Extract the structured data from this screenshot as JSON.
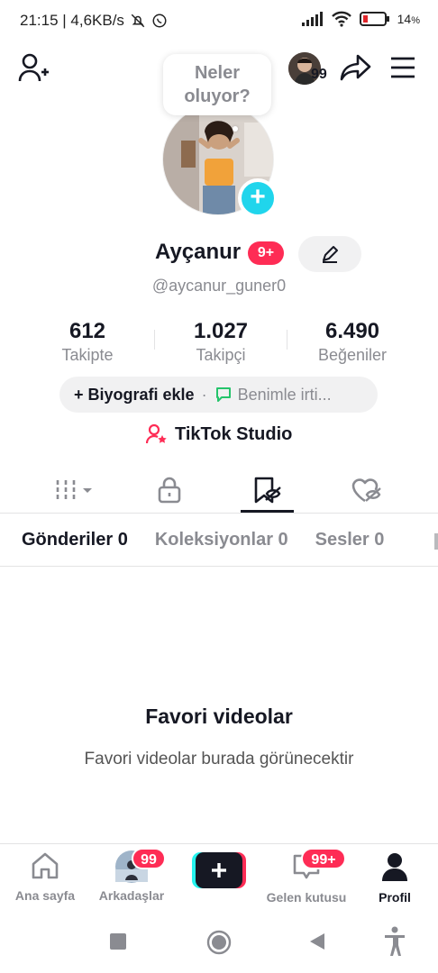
{
  "status_bar": {
    "time_speed": "21:15 | 4,6KB/s",
    "battery": "14",
    "battery_unit": "%"
  },
  "header": {
    "story_badge": "99",
    "bubble_line1": "Neler",
    "bubble_line2": "oluyor?"
  },
  "profile": {
    "display_name": "Ayçanur",
    "name_badge": "9+",
    "handle": "@aycanur_guner0"
  },
  "stats": [
    {
      "value": "612",
      "label": "Takipte"
    },
    {
      "value": "1.027",
      "label": "Takipçi"
    },
    {
      "value": "6.490",
      "label": "Beğeniler"
    }
  ],
  "bio": {
    "add_label": "+ Biyografi ekle",
    "separator": "·",
    "message_label": "Benimle irti..."
  },
  "studio": {
    "label": "TikTok Studio"
  },
  "subtabs": [
    {
      "label": "Gönderiler 0",
      "active": true
    },
    {
      "label": "Koleksiyonlar 0",
      "active": false
    },
    {
      "label": "Sesler 0",
      "active": false
    }
  ],
  "empty_state": {
    "title": "Favori videolar",
    "subtitle": "Favori videolar burada görünecektir"
  },
  "bottom_nav": {
    "home": "Ana sayfa",
    "friends": "Arkadaşlar",
    "friends_badge": "99",
    "inbox": "Gelen kutusu",
    "inbox_badge": "99+",
    "profile": "Profil"
  },
  "colors": {
    "accent_red": "#fe2c55",
    "accent_cyan": "#20d5ec",
    "text_primary": "#161823",
    "text_secondary": "#8a8b91"
  }
}
